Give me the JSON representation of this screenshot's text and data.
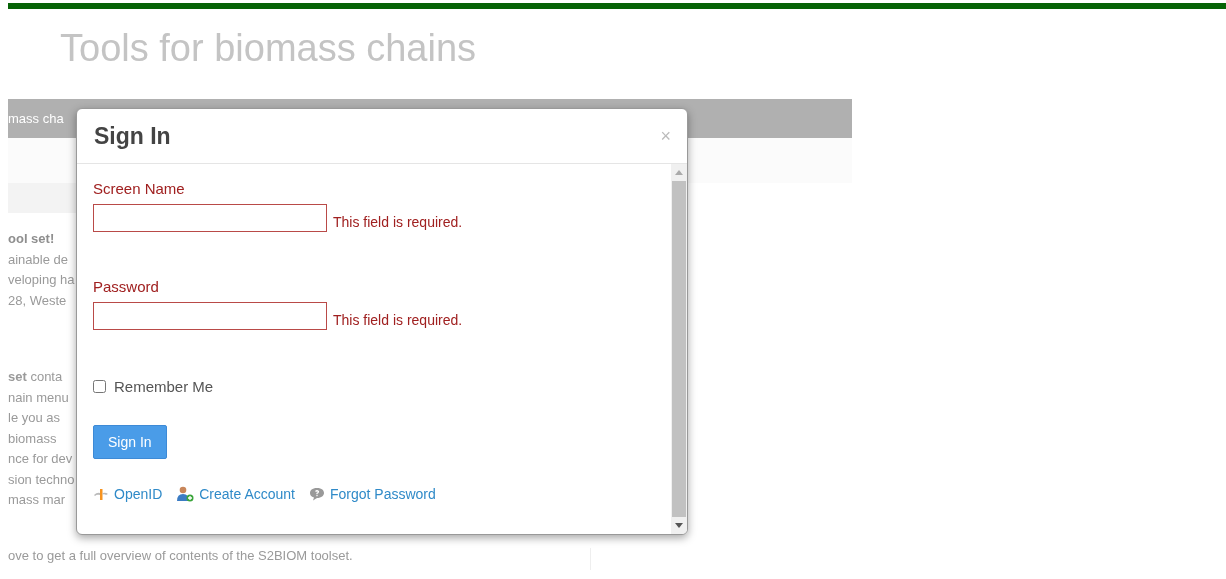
{
  "page": {
    "title": "Tools for biomass chains",
    "nav_bar": {
      "label": "mass cha"
    },
    "intro": {
      "heading": "ool set!",
      "lines": [
        "ainable de",
        "veloping ha",
        "28, Weste"
      ]
    },
    "contents": {
      "lines": [
        "**set** conta",
        "nain menu",
        "le you as",
        "biomass",
        "nce for dev",
        "sion techno",
        "mass mar"
      ]
    },
    "footer_text": "ove to get a full overview of contents of the S2BIOM toolset."
  },
  "dialog": {
    "title": "Sign In",
    "close": "×",
    "fields": [
      {
        "label": "Screen Name",
        "error": "This field is required.",
        "invalid": true
      },
      {
        "label": "Password",
        "error": "This field is required.",
        "invalid": true
      }
    ],
    "remember": {
      "label": "Remember Me",
      "checked": false
    },
    "submit": "Sign In",
    "links": [
      {
        "kind": "openid",
        "label": "OpenID"
      },
      {
        "kind": "create",
        "label": "Create Account"
      },
      {
        "kind": "forgot",
        "label": "Forgot Password"
      }
    ]
  }
}
